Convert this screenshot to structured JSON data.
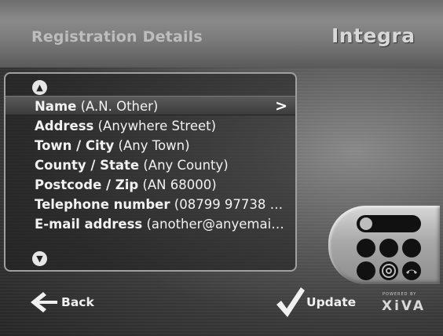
{
  "header": {
    "title": "Registration Details",
    "brand": "Integra"
  },
  "list": {
    "items": [
      {
        "label": "Name",
        "value": " (A.N. Other)",
        "selected": true
      },
      {
        "label": "Address",
        "value": " (Anywhere Street)"
      },
      {
        "label": "Town / City",
        "value": " (Any Town)"
      },
      {
        "label": "County / State",
        "value": " (Any County)"
      },
      {
        "label": "Postcode / Zip",
        "value": " (AN 68000)"
      },
      {
        "label": "Telephone number",
        "value": " (08799 97738 …"
      },
      {
        "label": "E-mail address",
        "value": " (another@anyemai…"
      }
    ]
  },
  "footer": {
    "back_label": "Back",
    "update_label": "Update",
    "powered_by": "POWERED BY",
    "platform": "XiVA"
  }
}
